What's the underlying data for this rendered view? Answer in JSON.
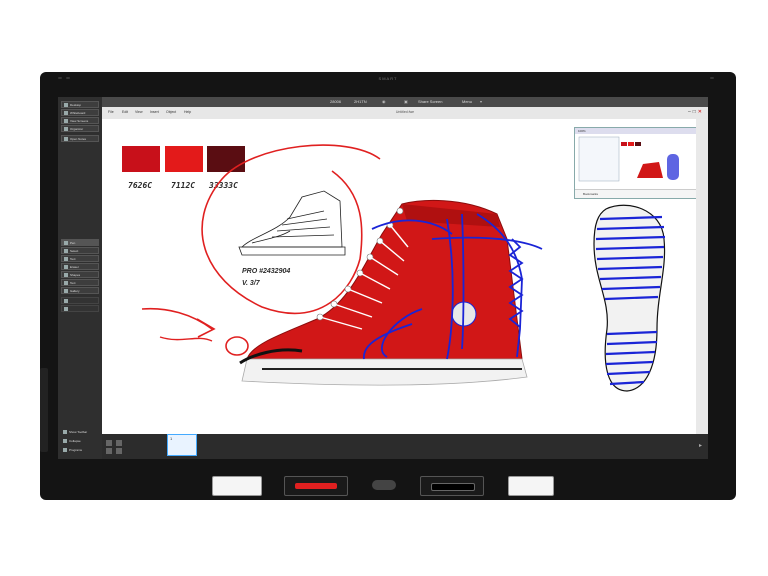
{
  "display": {
    "brand": "SMART"
  },
  "left_toolbar": {
    "top_items": [
      {
        "label": "Desktop"
      },
      {
        "label": "Whiteboard"
      },
      {
        "label": "View Screens"
      },
      {
        "label": "Organizer"
      },
      {
        "label": "Open Notes"
      }
    ],
    "tool_items": [
      {
        "label": "Pen"
      },
      {
        "label": "Select"
      },
      {
        "label": "Text"
      },
      {
        "label": "Eraser"
      },
      {
        "label": "Shapes"
      },
      {
        "label": "Text"
      },
      {
        "label": "Gallery"
      }
    ],
    "bottom_items": [
      {
        "label": "Show Toolbar"
      },
      {
        "label": "Collapse"
      },
      {
        "label": "Programs"
      }
    ]
  },
  "top_bar": {
    "zoom": "28006",
    "size": "2H1TN",
    "share_label": "Share Screen",
    "menu_label": "Menu"
  },
  "menu_bar": {
    "items": [
      "File",
      "Edit",
      "View",
      "Insert",
      "Object",
      "Help"
    ],
    "document_title": "Untitled.fwe"
  },
  "canvas": {
    "swatches": [
      {
        "label": "7626C",
        "color": "#c8101a"
      },
      {
        "label": "7112C",
        "color": "#e31a1a"
      },
      {
        "label": "33333C",
        "color": "#5a0d12"
      }
    ],
    "sketch_note_line1": "PRO #2432904",
    "sketch_note_line2": "V. 3/7",
    "colors": {
      "ink_red": "#e02020",
      "ink_blue": "#1a24d6",
      "shoe_red": "#d11717"
    }
  },
  "minimap": {
    "header": "100%",
    "footer": "Bookmarks"
  },
  "status_bar": {
    "page_count": "1"
  }
}
